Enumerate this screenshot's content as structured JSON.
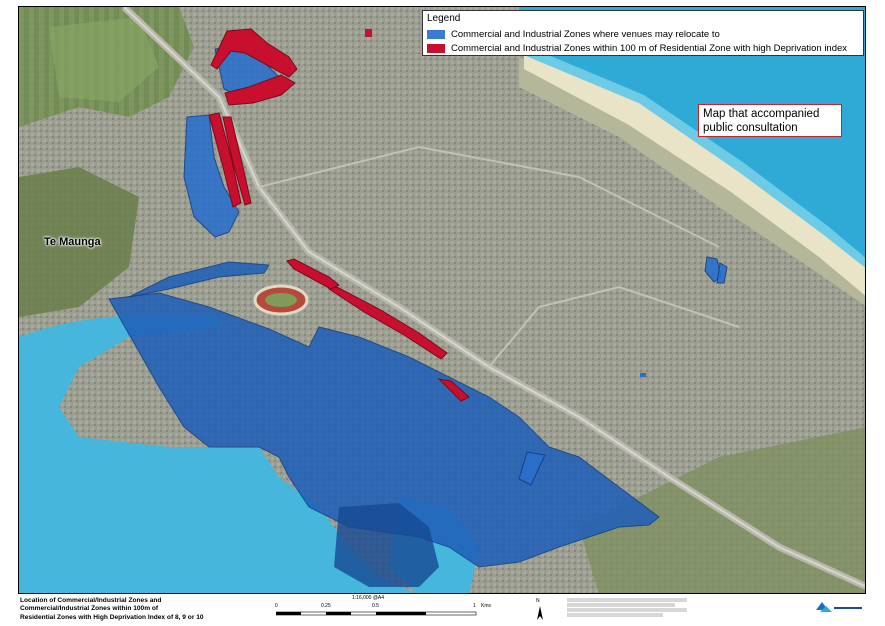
{
  "legend": {
    "title": "Legend",
    "items": [
      {
        "label": "Commercial and Industrial Zones where venues may relocate to",
        "color": "#3a7bd5"
      },
      {
        "label": "Commercial and Industrial Zones within 100 m of Residential Zone with high Deprivation index",
        "color": "#c8102e"
      }
    ]
  },
  "annotation": {
    "line1": "Map that accompanied",
    "line2": "public consultation"
  },
  "place_label": "Te Maunga",
  "title_block": {
    "line1": "Location of Commercial/Industrial Zones and",
    "line2": "Commercial/Industrial Zones within 100m of",
    "line3": "Residential Zones with High Deprivation Index of 8, 9 or 10"
  },
  "scale_bar": {
    "ratio": "1:16,000 @A4",
    "ticks": [
      "0",
      "0.25",
      "0.5",
      "1"
    ],
    "unit": "Kms"
  },
  "north_label": "N",
  "colors": {
    "ocean": "#2fa9d6",
    "harbour": "#46b6dd",
    "zone_blue": "#1f5fb8",
    "zone_red": "#c8102e",
    "urban": "#9a9c8e",
    "farmland": "#6f8a4e"
  }
}
